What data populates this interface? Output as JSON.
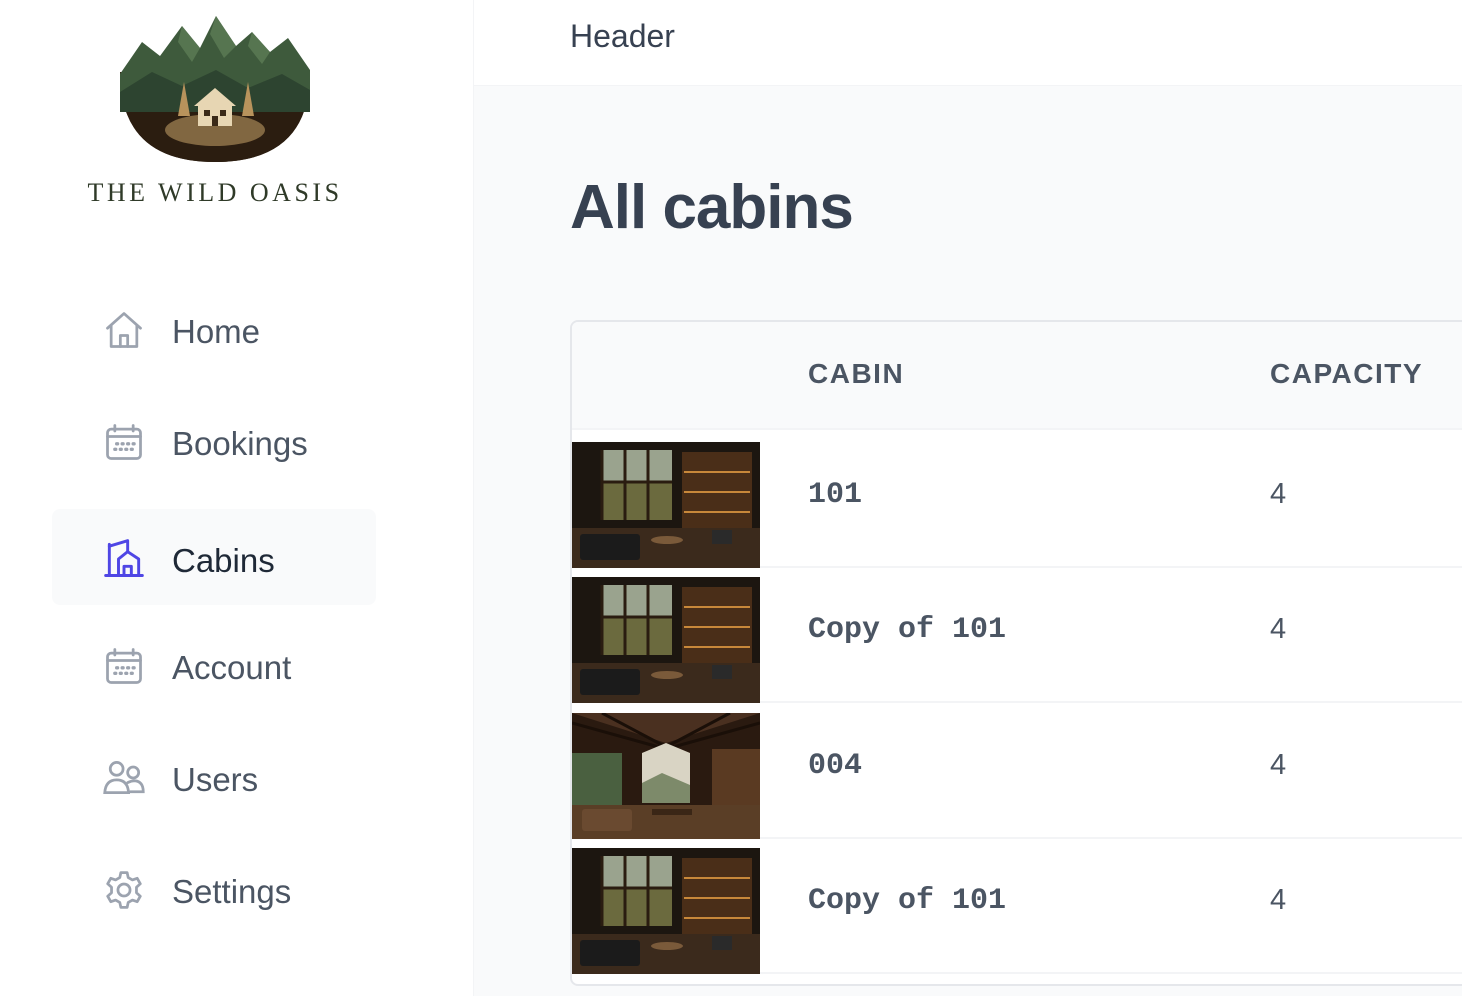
{
  "brand": {
    "name": "THE WILD OASIS"
  },
  "sidebar": {
    "items": [
      {
        "label": "Home",
        "icon": "home-icon",
        "active": false
      },
      {
        "label": "Bookings",
        "icon": "calendar-icon",
        "active": false
      },
      {
        "label": "Cabins",
        "icon": "cabin-icon",
        "active": true
      },
      {
        "label": "Account",
        "icon": "calendar-icon",
        "active": false
      },
      {
        "label": "Users",
        "icon": "users-icon",
        "active": false
      },
      {
        "label": "Settings",
        "icon": "gear-icon",
        "active": false
      }
    ]
  },
  "header": {
    "title": "Header"
  },
  "main": {
    "title": "All cabins",
    "table": {
      "columns": [
        "",
        "CABIN",
        "CAPACITY"
      ],
      "rows": [
        {
          "name": "101",
          "capacity": "4"
        },
        {
          "name": "Copy of 101",
          "capacity": "4"
        },
        {
          "name": "004",
          "capacity": "4"
        },
        {
          "name": "Copy of 101",
          "capacity": "4"
        }
      ]
    }
  },
  "colors": {
    "accent": "#4f46e5",
    "text": "#374151",
    "muted": "#6b7280",
    "brand_green": "#2f3a28"
  }
}
